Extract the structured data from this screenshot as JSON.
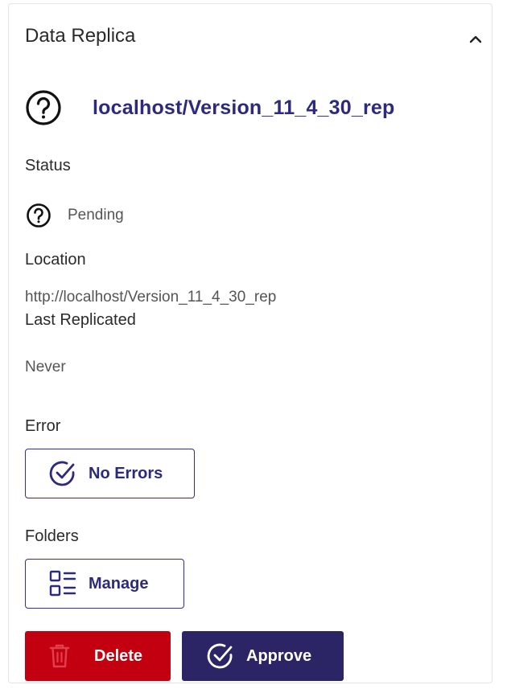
{
  "header": {
    "title": "Data Replica",
    "collapse_icon": "chevron-up-icon"
  },
  "replica": {
    "status_icon": "question-circle-icon",
    "name": "localhost/Version_11_4_30_rep"
  },
  "status": {
    "label": "Status",
    "icon": "question-circle-icon",
    "value": "Pending"
  },
  "location": {
    "label": "Location",
    "value": "http://localhost/Version_11_4_30_rep"
  },
  "last_replicated": {
    "label": "Last Replicated",
    "value": "Never"
  },
  "error": {
    "label": "Error",
    "button_label": "No Errors",
    "button_icon": "check-circle-icon"
  },
  "folders": {
    "label": "Folders",
    "button_label": "Manage",
    "button_icon": "list-grid-icon"
  },
  "actions": {
    "delete_label": "Delete",
    "delete_icon": "trash-icon",
    "approve_label": "Approve",
    "approve_icon": "check-circle-icon"
  },
  "colors": {
    "accent": "#2c2a7d",
    "delete": "#c2000f",
    "approve": "#2b2566"
  }
}
